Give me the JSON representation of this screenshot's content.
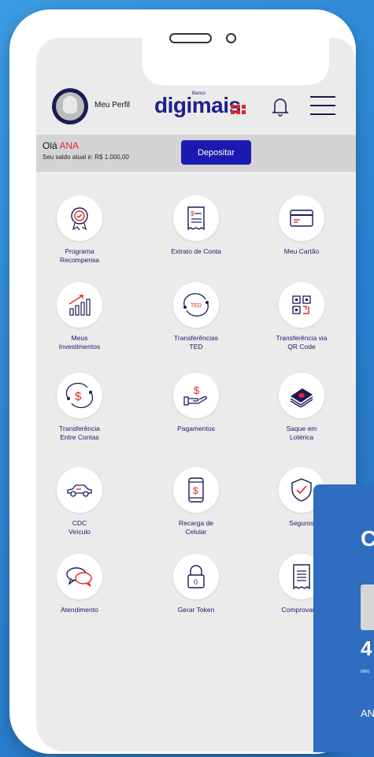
{
  "header": {
    "profile_label": "Meu Perfil",
    "logo_banco": "Banco",
    "logo_text": "digimais"
  },
  "balance": {
    "greeting": "Olá",
    "name": "ANA",
    "balance_text": "Seu saldo atual é: R$ 1.000,00",
    "deposit_label": "Depositar"
  },
  "tiles": [
    {
      "label": "Programa\nRecompensa",
      "icon": "award-medal-icon"
    },
    {
      "label": "Extrato de Conta",
      "icon": "receipt-icon"
    },
    {
      "label": "Meu Cartão",
      "icon": "credit-card-icon"
    },
    {
      "label": "Meus\nInvestimentos",
      "icon": "growth-chart-icon"
    },
    {
      "label": "Transferências\nTED",
      "icon": "ted-transfer-icon"
    },
    {
      "label": "Transferência via\nQR Code",
      "icon": "qr-code-icon"
    },
    {
      "label": "Transferência\nEntre Contas",
      "icon": "account-transfer-icon"
    },
    {
      "label": "Pagamentos",
      "icon": "payment-hand-icon"
    },
    {
      "label": "Saque em\nLotérica",
      "icon": "cash-stack-icon"
    },
    {
      "label": "CDC\nVeículo",
      "icon": "car-icon"
    },
    {
      "label": "Recarga de\nCelular",
      "icon": "phone-recharge-icon"
    },
    {
      "label": "Seguros",
      "icon": "shield-check-icon"
    },
    {
      "label": "Atendimento",
      "icon": "chat-bubbles-icon"
    },
    {
      "label": "Gerar Token",
      "icon": "lock-token-icon"
    },
    {
      "label": "Comprovante",
      "icon": "voucher-icon"
    }
  ],
  "card": {
    "letter": "C",
    "number_fragment": "4",
    "small_text": "0000",
    "name_fragment": "AN"
  },
  "colors": {
    "brand_blue": "#1a1ab0",
    "brand_red": "#e2262b",
    "background": "#2f8fd8"
  }
}
